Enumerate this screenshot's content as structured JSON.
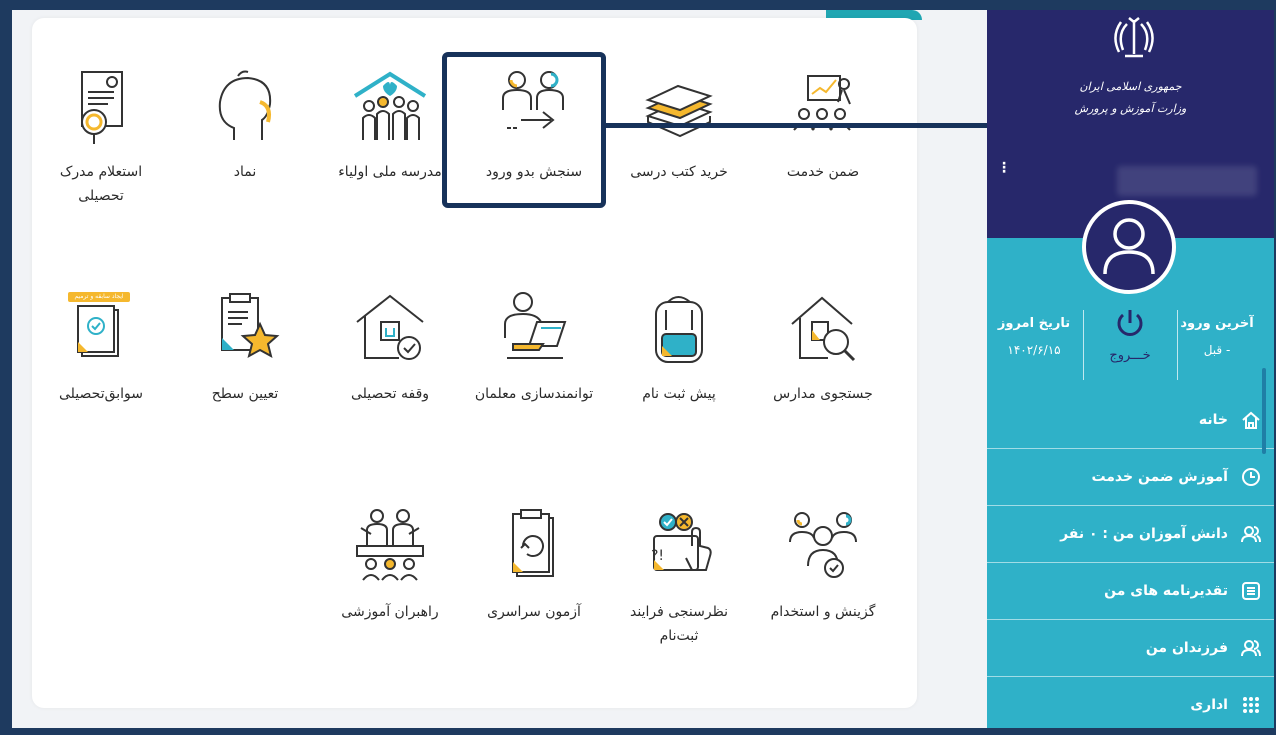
{
  "tiles": [
    {
      "label": "ضمن خدمت",
      "icon": "presentation-icon"
    },
    {
      "label": "خرید کتب درسی",
      "icon": "books-icon"
    },
    {
      "label": "سنجش بدو ورود",
      "icon": "entry-assessment-icon"
    },
    {
      "label": "مدرسه ملی اولیاء",
      "icon": "family-house-icon"
    },
    {
      "label": "نماد",
      "icon": "head-profile-icon"
    },
    {
      "label": "استعلام مدرک تحصیلی",
      "icon": "certificate-search-icon"
    },
    {
      "label": "جستجوی مدارس",
      "icon": "school-search-icon"
    },
    {
      "label": "پیش ثبت نام",
      "icon": "backpack-icon"
    },
    {
      "label": "توانمندسازی معلمان",
      "icon": "teacher-laptop-icon"
    },
    {
      "label": "وقفه تحصیلی",
      "icon": "house-check-icon"
    },
    {
      "label": "تعیین سطح",
      "icon": "clipboard-star-icon"
    },
    {
      "label": "سوابق‌تحصیلی",
      "icon": "records-check-icon"
    },
    {
      "label": "گزینش و استخدام",
      "icon": "recruitment-icon"
    },
    {
      "label": "نظرسنجی فرایند ثبت‌نام",
      "icon": "survey-touch-icon"
    },
    {
      "label": "آزمون سراسری",
      "icon": "exam-cycle-icon"
    },
    {
      "label": "راهبران آموزشی",
      "icon": "leaders-icon"
    }
  ],
  "records_badge": "ایجاد سابقه و ترمیم",
  "sidebar": {
    "org_line1": "جمهوری اسلامی ایران",
    "org_line2": "وزارت آموزش و پرورش",
    "menu_dots": "⋮",
    "last_login_label": "آخرین ورود",
    "last_login_value": "- قبل",
    "logout_label": "خـــروج",
    "today_label": "تاریخ امروز",
    "today_value": "۱۴۰۲/۶/۱۵",
    "menu": [
      {
        "label": "خانه",
        "icon": "home-icon"
      },
      {
        "label": "آموزش ضمن خدمت",
        "icon": "clock-icon"
      },
      {
        "label": "دانش آموزان من : ۰ نفر",
        "icon": "users-icon"
      },
      {
        "label": "تقدیرنامه های من",
        "icon": "list-icon"
      },
      {
        "label": "فرزندان من",
        "icon": "users-icon"
      },
      {
        "label": "اداری",
        "icon": "grid-dots-icon"
      }
    ]
  },
  "colors": {
    "navy": "#27286b",
    "teal": "#2fb1c8",
    "accent_yellow": "#f5b82e",
    "icon_teal": "#2fb1c8",
    "frame": "#1e3a5f"
  }
}
